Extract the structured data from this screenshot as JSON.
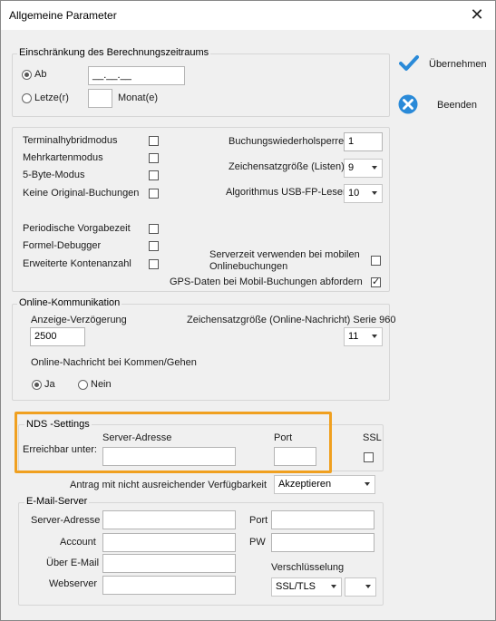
{
  "window": {
    "title": "Allgemeine Parameter"
  },
  "side_buttons": {
    "apply_label": "Übernehmen",
    "close_label": "Beenden"
  },
  "period": {
    "legend": "Einschränkung des Berechnungszeitraums",
    "ab_label": "Ab",
    "ab_value": "__.__.__",
    "letzte_label": "Letze(r)",
    "letzte_value": "",
    "monat_label": "Monat(e)"
  },
  "options": {
    "checkboxes_left": [
      {
        "label": "Terminalhybridmodus",
        "checked": false
      },
      {
        "label": "Mehrkartenmodus",
        "checked": false
      },
      {
        "label": "5-Byte-Modus",
        "checked": false
      },
      {
        "label": "Keine Original-Buchungen",
        "checked": false
      },
      {
        "label": "Periodische Vorgabezeit",
        "checked": false
      },
      {
        "label": "Formel-Debugger",
        "checked": false
      },
      {
        "label": "Erweiterte Kontenanzahl",
        "checked": false
      }
    ],
    "buchungswiederholsperre_label": "Buchungswiederholsperre",
    "buchungswiederholsperre_value": "1",
    "zeichensatz_label": "Zeichensatzgröße (Listen)",
    "zeichensatz_value": "9",
    "algorithmus_label": "Algorithmus USB-FP-Leser",
    "algorithmus_value": "10",
    "serverzeit_label_1": "Serverzeit verwenden bei mobilen",
    "serverzeit_label_2": "Onlinebuchungen",
    "serverzeit_checked": false,
    "gps_label": "GPS-Daten bei Mobil-Buchungen abfordern",
    "gps_checked": true
  },
  "online": {
    "legend": "Online-Kommunikation",
    "anzeige_label": "Anzeige-Verzögerung",
    "anzeige_value": "2500",
    "zeichensatz_label": "Zeichensatzgröße (Online-Nachricht) Serie 960",
    "zeichensatz_value": "11",
    "nachricht_label": "Online-Nachricht bei Kommen/Gehen",
    "ja_label": "Ja",
    "nein_label": "Nein"
  },
  "nds": {
    "legend": "NDS -Settings",
    "erreichbar_label": "Erreichbar unter:",
    "server_label": "Server-Adresse",
    "server_value": "",
    "port_label": "Port",
    "port_value": "",
    "ssl_label": "SSL",
    "ssl_checked": false
  },
  "antrag": {
    "label": "Antrag mit nicht ausreichender Verfügbarkeit",
    "value": "Akzeptieren"
  },
  "email": {
    "legend": "E-Mail-Server",
    "server_label": "Server-Adresse",
    "server_value": "",
    "port_label": "Port",
    "port_value": "",
    "account_label": "Account",
    "account_value": "",
    "pw_label": "PW",
    "pw_value": "",
    "ueber_label": "Über E-Mail",
    "ueber_value": "",
    "webserver_label": "Webserver",
    "webserver_value": "",
    "verschluesselung_label": "Verschlüsselung",
    "verschluesselung_value": "SSL/TLS",
    "second_select_value": ""
  },
  "colors": {
    "accent_blue": "#2a8ad8",
    "highlight_orange": "#f0a020"
  }
}
